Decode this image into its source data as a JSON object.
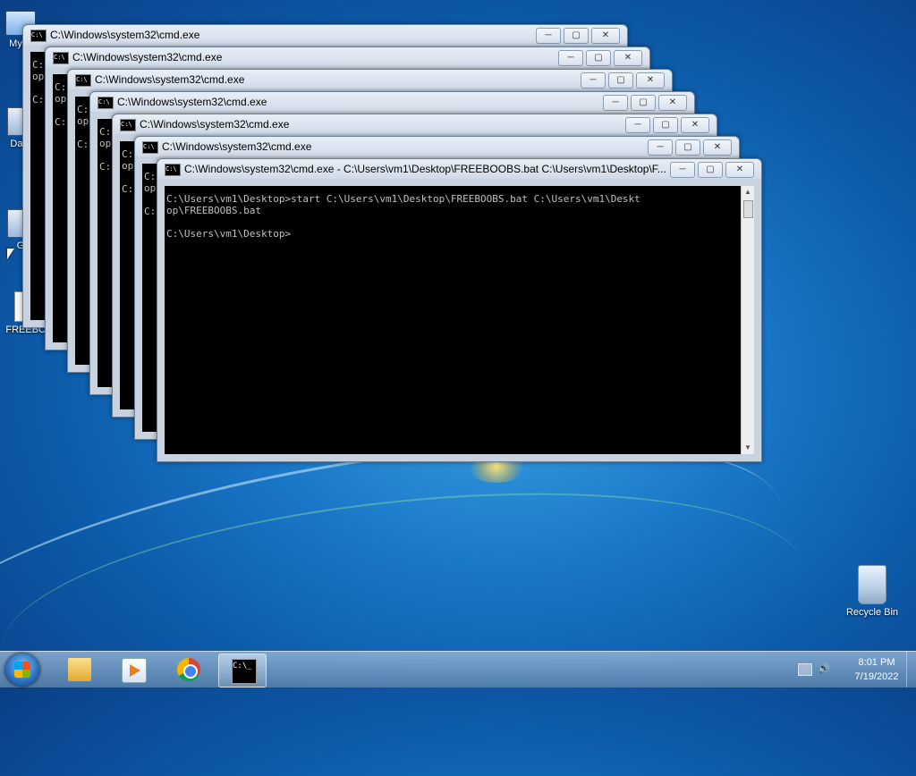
{
  "desktop": {
    "icons": [
      {
        "label": "My C",
        "icon": "computer-icon"
      },
      {
        "label": "Data",
        "icon": "app-icon"
      },
      {
        "label": "G",
        "icon": "app-icon"
      },
      {
        "label": "FREEBO",
        "icon": "batch-file-icon"
      },
      {
        "label": "Recycle Bin",
        "icon": "recycle-bin-icon"
      }
    ]
  },
  "windows": [
    {
      "title": "C:\\Windows\\system32\\cmd.exe",
      "console": "C:\nop\n\nC:"
    },
    {
      "title": "C:\\Windows\\system32\\cmd.exe",
      "console": "C:\nop\n\nC:"
    },
    {
      "title": "C:\\Windows\\system32\\cmd.exe",
      "console": "C:\nop\n\nC:"
    },
    {
      "title": "C:\\Windows\\system32\\cmd.exe",
      "console": "C:\nop\n\nC:"
    },
    {
      "title": "C:\\Windows\\system32\\cmd.exe",
      "console": "C:\nop\n\nC:"
    },
    {
      "title": "C:\\Windows\\system32\\cmd.exe",
      "console": "C:\nop\n\nC:"
    },
    {
      "title": "C:\\Windows\\system32\\cmd.exe - C:\\Users\\vm1\\Desktop\\FREEBOOBS.bat  C:\\Users\\vm1\\Desktop\\F...",
      "console": "C:\\Users\\vm1\\Desktop>start C:\\Users\\vm1\\Desktop\\FREEBOOBS.bat C:\\Users\\vm1\\Deskt\nop\\FREEBOOBS.bat\n\nC:\\Users\\vm1\\Desktop>"
    }
  ],
  "window_controls": {
    "minimize": "─",
    "maximize": "▢",
    "close": "✕"
  },
  "taskbar": {
    "items": [
      {
        "name": "windows-explorer",
        "label": ""
      },
      {
        "name": "media-player",
        "label": ""
      },
      {
        "name": "chrome",
        "label": ""
      },
      {
        "name": "command-prompt",
        "label": "C:\\_",
        "active": true
      }
    ],
    "clock": {
      "time": "8:01 PM",
      "date": "7/19/2022"
    }
  }
}
